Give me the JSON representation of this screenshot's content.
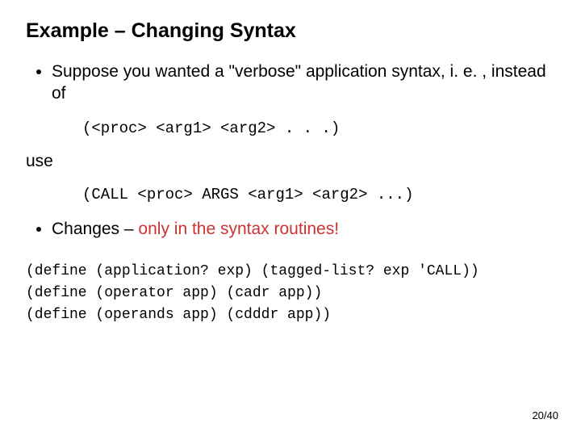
{
  "title": "Example – Changing Syntax",
  "bullet1": "Suppose you wanted a \"verbose\" application syntax, i. e. , instead of",
  "code1": "(<proc> <arg1> <arg2> . . .)",
  "use": "use",
  "code2": "(CALL <proc> ARGS <arg1> <arg2> ...)",
  "bullet2_pre": "Changes – ",
  "bullet2_accent": "only in the syntax routines!",
  "defs": "(define (application? exp) (tagged-list? exp 'CALL))\n(define (operator app) (cadr app))\n(define (operands app) (cdddr app))",
  "pagenum": "20/40"
}
